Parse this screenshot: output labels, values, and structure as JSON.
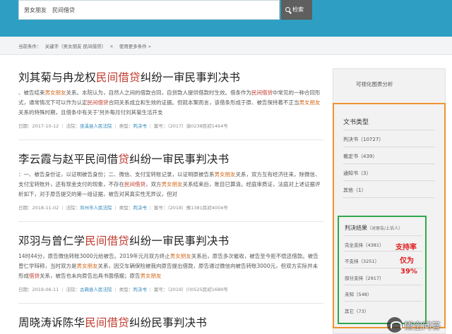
{
  "search": {
    "keyword1": "男女朋友",
    "keyword2": "民间借贷",
    "button_label": "检索"
  },
  "filters": {
    "label": "当前条件：",
    "condition": "关键字（男女朋友   民间借贷）",
    "more": "使用更多条件 »"
  },
  "results": [
    {
      "title_pre": "刘其菊与冉龙权",
      "title_hl": "民间借贷",
      "title_post": "纠纷一审民事判决书",
      "body": [
        {
          "t": "、被告结束",
          "c": ""
        },
        {
          "t": "男女朋友",
          "c": "o"
        },
        {
          "t": "关系。本院认为，自然人之间的借款合同，自贷款人提供借款时生效。借条作为",
          "c": ""
        },
        {
          "t": "民间借贷",
          "c": "r"
        },
        {
          "t": "中常见的一种合同形式，通常情况下可以作为认定",
          "c": ""
        },
        {
          "t": "民间借贷",
          "c": "r"
        },
        {
          "t": "合同关系成立和生效的证据。但就本案而言，该借条形成于原、被告保持着不正当",
          "c": ""
        },
        {
          "t": "男女朋友",
          "c": "o"
        },
        {
          "t": "关系的特殊时期，且借条中有关于'另外每月付刘其菊生活开支",
          "c": ""
        }
      ],
      "date": "日期：2017-10-12",
      "court_label": "法院：",
      "court": "巫溪县人民法院",
      "type_label": "类型：",
      "type": "判决书",
      "case_no": "案号：（2017）渝0238民初1464号"
    },
    {
      "title_pre": "李云霞与赵平",
      "title_hl": "民间借",
      "title_mid": "贷",
      "title_post": "纠纷一审民事判决书",
      "body": [
        {
          "t": "：一、被告身份证，以证明被告身份；二、微信、支付宝转账记录，以证明原被告系",
          "c": ""
        },
        {
          "t": "男女朋友",
          "c": "o"
        },
        {
          "t": "关系，双方互有经济往来，除微信、支付宝转账外，还有现金支付的现象，不存在",
          "c": ""
        },
        {
          "t": "民间借贷",
          "c": "r"
        },
        {
          "t": "，双方",
          "c": ""
        },
        {
          "t": "男女朋友",
          "c": "o"
        },
        {
          "t": "关系结束后，账目已算清。经庭审质证，法庭对上述证据评析如下，对于原告提交的第一组证据，被告对其真实性无异议，但对",
          "c": ""
        }
      ],
      "date": "日期：2018-11-02",
      "court_label": "法院：",
      "court": "邓州市人民法院",
      "type_label": "类型：",
      "type": "判决书",
      "case_no": "案号：（2018）豫1381民初4004号"
    },
    {
      "title_pre": "邓羽与曾仁学",
      "title_hl": "民间借贷",
      "title_post": "纠纷一审民事判决书",
      "body": [
        {
          "t": "14时44分，原告微信转账3000元给被告。2019年元月双方终止",
          "c": ""
        },
        {
          "t": "男女朋友",
          "c": "o"
        },
        {
          "t": "关系后，原告多次催收，被告至今拒不偿还借款。被告曾仁学辩称，当时双方是",
          "c": ""
        },
        {
          "t": "男女朋友",
          "c": "o"
        },
        {
          "t": "关系，因交车辆保险被我向原告提出借款，原告通过微信向被告转账3000元，但双方实际并未形成",
          "c": ""
        },
        {
          "t": "借贷",
          "c": "r"
        },
        {
          "t": "关系，被告也未向原告出具书面借据；原告",
          "c": ""
        },
        {
          "t": "男女朋友",
          "c": "o"
        }
      ],
      "date": "日期：2019-06-11",
      "court_label": "法院：",
      "court": "古蔺县人民法院",
      "type_label": "类型：",
      "type": "判决书",
      "case_no": "案号：（2019）川0525民初1689号"
    },
    {
      "title_pre": "周晓涛诉陈华",
      "title_hl": "民间借贷",
      "title_post": "纠纷民事判决书"
    }
  ],
  "sidebar": {
    "heading": "可视化图表分析",
    "doc_type": {
      "title": "文书类型",
      "items": [
        "判决书（10727）",
        "裁定书（439）",
        "通知书（3）",
        "其他（1）"
      ]
    },
    "verdict": {
      "title": "判决结果",
      "subtitle": "（对原告/上诉人）",
      "items": [
        "完全支持（4381）",
        "不支持（3251）",
        "部分支持（2917）",
        "未知（548）",
        "其它（73）"
      ]
    },
    "annotation": [
      "支持率",
      "仅为",
      "39%"
    ]
  },
  "watermark": {
    "text": "悟空问答"
  },
  "colors": {
    "topbar": "#2e9fc3",
    "highlight_red": "#c0392b",
    "highlight_orange": "#d2691e",
    "orange_box": "#f0922e",
    "green_box": "#2fa84f",
    "annotation_red": "#e02020"
  }
}
